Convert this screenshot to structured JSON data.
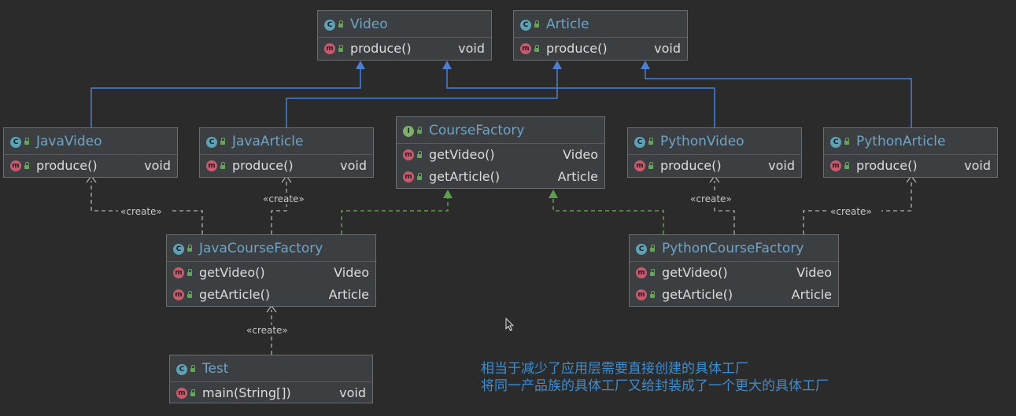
{
  "classes": {
    "video": {
      "name": "Video",
      "kind": "C",
      "methods": [
        {
          "name": "produce()",
          "type": "void"
        }
      ]
    },
    "article": {
      "name": "Article",
      "kind": "C",
      "methods": [
        {
          "name": "produce()",
          "type": "void"
        }
      ]
    },
    "java_video": {
      "name": "JavaVideo",
      "kind": "C",
      "methods": [
        {
          "name": "produce()",
          "type": "void"
        }
      ]
    },
    "java_article": {
      "name": "JavaArticle",
      "kind": "C",
      "methods": [
        {
          "name": "produce()",
          "type": "void"
        }
      ]
    },
    "course_factory": {
      "name": "CourseFactory",
      "kind": "I",
      "methods": [
        {
          "name": "getVideo()",
          "type": "Video"
        },
        {
          "name": "getArticle()",
          "type": "Article"
        }
      ]
    },
    "python_video": {
      "name": "PythonVideo",
      "kind": "C",
      "methods": [
        {
          "name": "produce()",
          "type": "void"
        }
      ]
    },
    "python_article": {
      "name": "PythonArticle",
      "kind": "C",
      "methods": [
        {
          "name": "produce()",
          "type": "void"
        }
      ]
    },
    "java_course_factory": {
      "name": "JavaCourseFactory",
      "kind": "C",
      "methods": [
        {
          "name": "getVideo()",
          "type": "Video"
        },
        {
          "name": "getArticle()",
          "type": "Article"
        }
      ]
    },
    "python_course_factory": {
      "name": "PythonCourseFactory",
      "kind": "C",
      "methods": [
        {
          "name": "getVideo()",
          "type": "Video"
        },
        {
          "name": "getArticle()",
          "type": "Article"
        }
      ]
    },
    "test": {
      "name": "Test",
      "kind": "C",
      "methods": [
        {
          "name": "main(String[])",
          "type": "void"
        }
      ]
    }
  },
  "edge_label": "«create»",
  "caption": {
    "line1": "相当于减少了应用层需要直接创建的具体工厂",
    "line2": "将同一产品族的具体工厂又给封装成了一个更大的具体工厂"
  },
  "colors": {
    "background": "#2b2b2b",
    "box": "#3c3f41",
    "inheritance": "#4a7fd4",
    "realization": "#5f9e4f",
    "dependency": "#b0b0b0",
    "caption": "#3f8ccf"
  }
}
